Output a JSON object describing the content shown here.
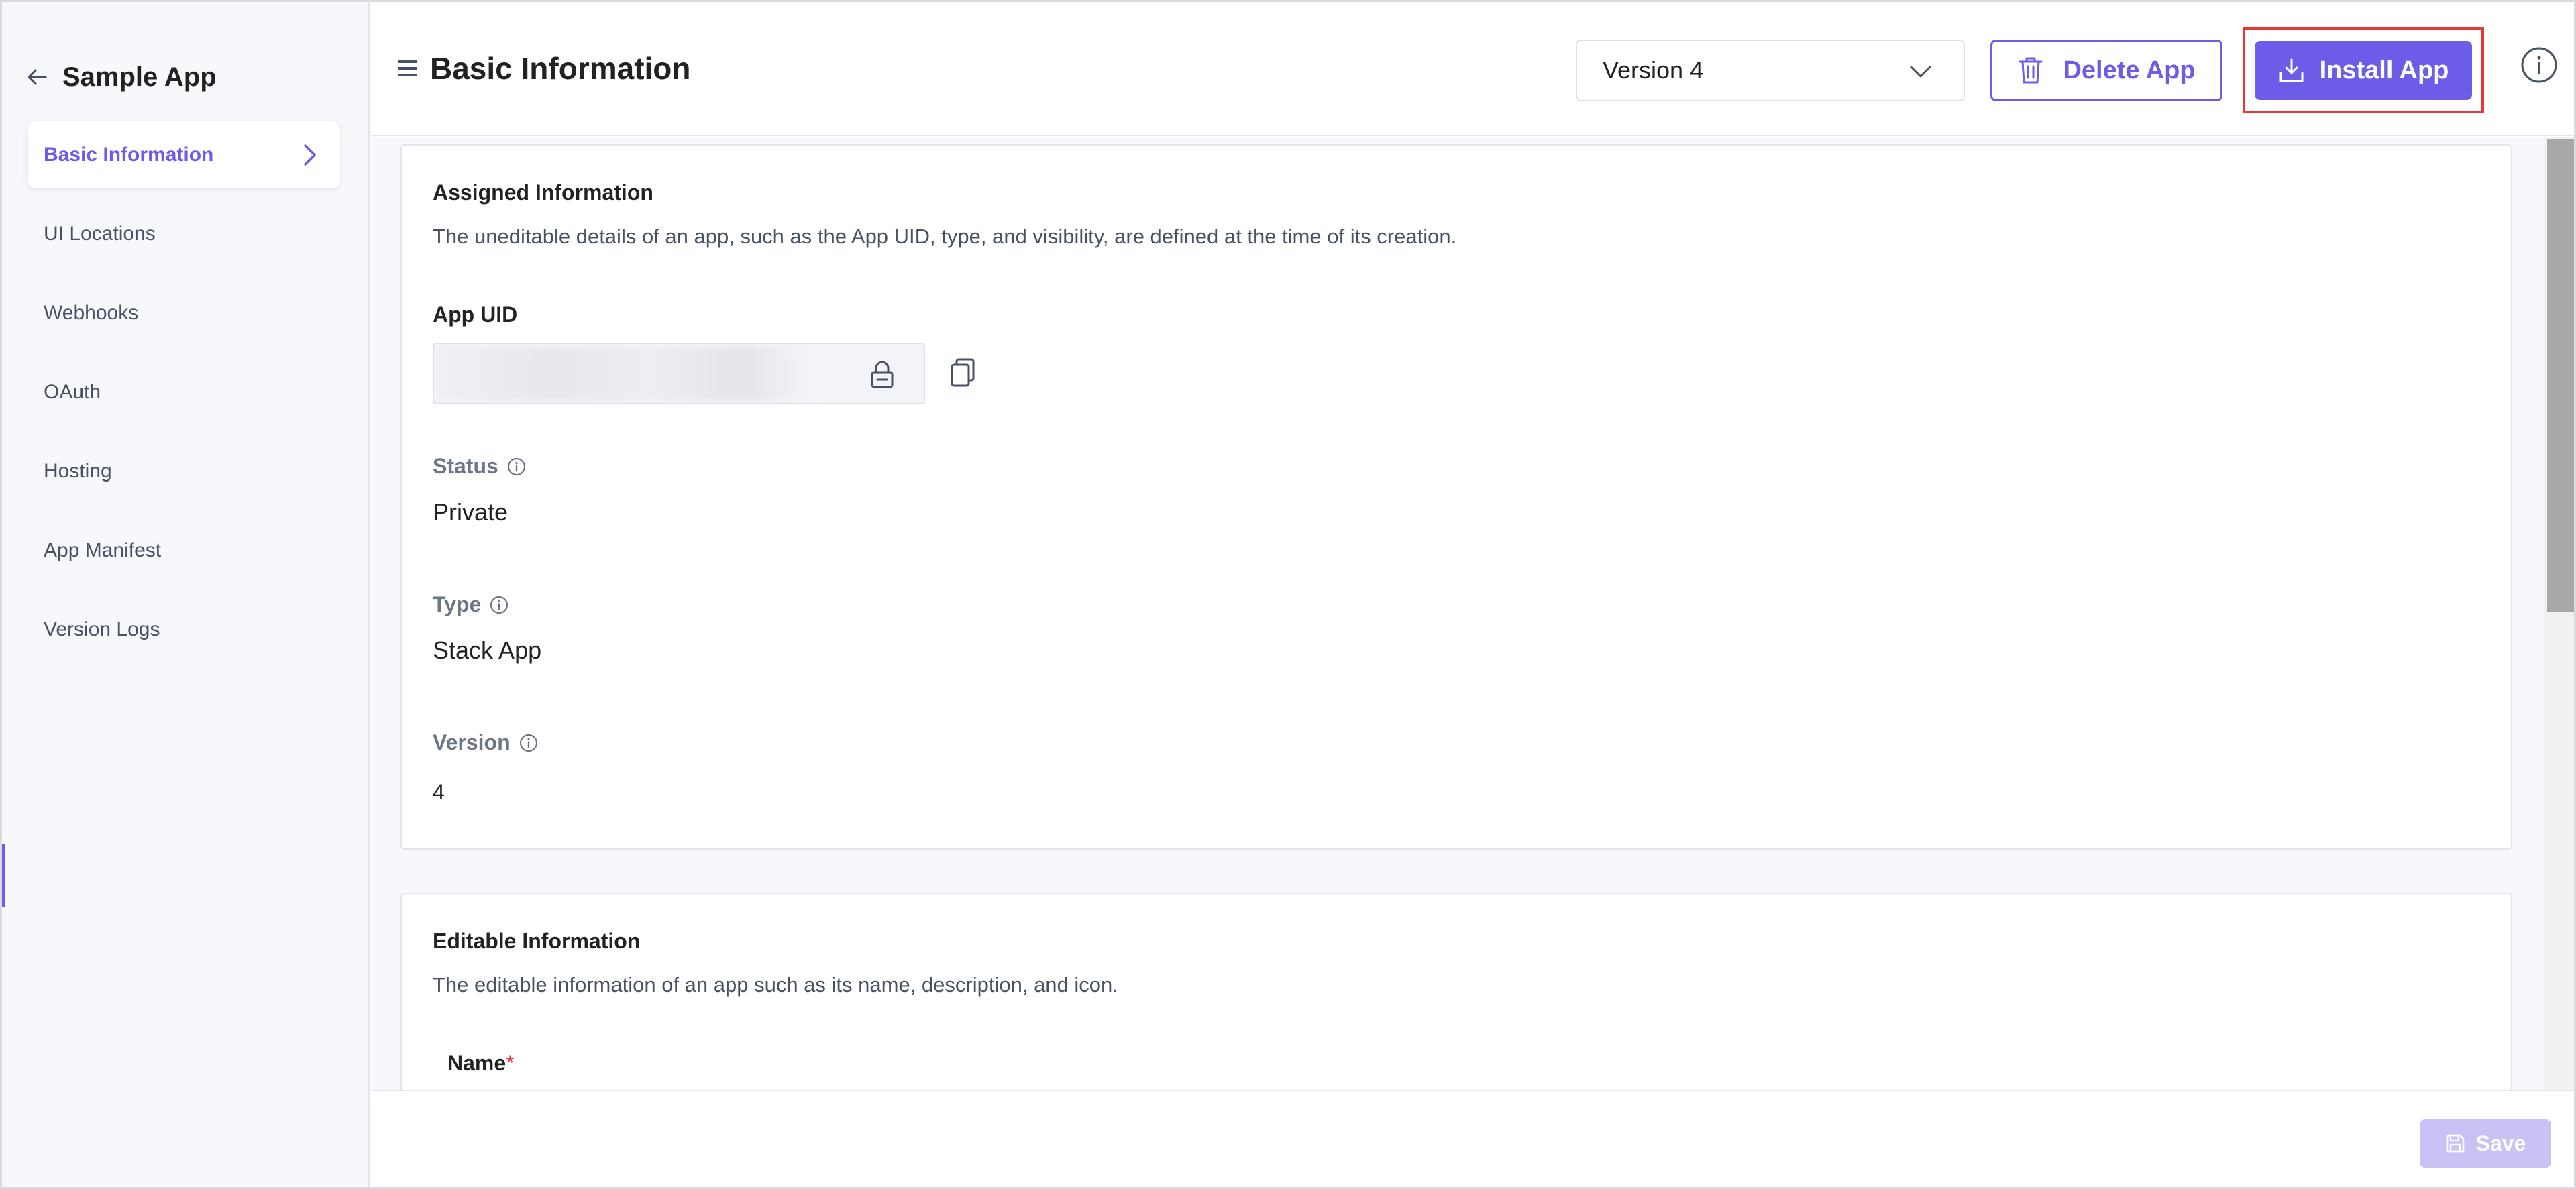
{
  "sidebar": {
    "app_name": "Sample App",
    "items": [
      {
        "label": "Basic Information",
        "active": true
      },
      {
        "label": "UI Locations"
      },
      {
        "label": "Webhooks"
      },
      {
        "label": "OAuth"
      },
      {
        "label": "Hosting"
      },
      {
        "label": "App Manifest"
      },
      {
        "label": "Version Logs"
      }
    ]
  },
  "header": {
    "title": "Basic Information",
    "version_selected": "Version 4",
    "delete_label": "Delete App",
    "install_label": "Install App"
  },
  "assigned": {
    "title": "Assigned Information",
    "description": "The uneditable details of an app, such as the App UID, type, and visibility, are defined at the time of its creation.",
    "uid_label": "App UID",
    "status_label": "Status",
    "status_value": "Private",
    "type_label": "Type",
    "type_value": "Stack App",
    "version_label": "Version",
    "version_value": "4"
  },
  "editable": {
    "title": "Editable Information",
    "description": "The editable information of an app such as its name, description, and icon.",
    "name_label": "Name",
    "required_mark": "*"
  },
  "footer": {
    "save_label": "Save"
  },
  "colors": {
    "accent": "#6c5ce7",
    "highlight_border": "#e53935",
    "save_disabled": "#c9c3f5"
  }
}
